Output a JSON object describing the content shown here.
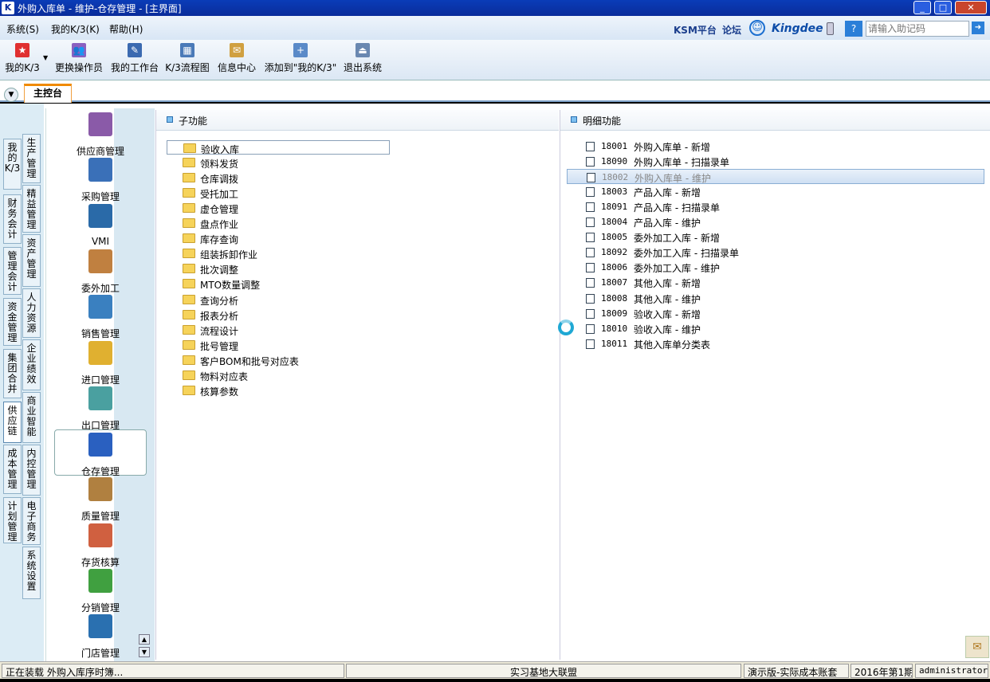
{
  "window": {
    "title": "外购入库单 - 维护-仓存管理 - [主界面]",
    "app_icon": "K",
    "min": "_",
    "max": "□",
    "close": "✕"
  },
  "menu": {
    "items": [
      "系统(S)",
      "我的K/3(K)",
      "帮助(H)"
    ],
    "ksm": "KSM平台",
    "forum": "论坛",
    "brand": "Kingdee",
    "search_placeholder": "请输入助记码"
  },
  "toolbar": {
    "items": [
      "我的K/3",
      "更换操作员",
      "我的工作台",
      "K/3流程图",
      "信息中心",
      "添加到\"我的K/3\"",
      "退出系统"
    ]
  },
  "tabs": {
    "main": "主控台"
  },
  "vtabs": {
    "col1": [
      "我的K/3",
      "财务会计",
      "管理会计",
      "资金管理",
      "集团合并",
      "供应链",
      "成本管理",
      "计划管理"
    ],
    "col2": [
      "生产管理",
      "精益管理",
      "资产管理",
      "人力资源",
      "企业绩效",
      "商业智能",
      "内控管理",
      "电子商务",
      "系统设置"
    ],
    "active": "供应链"
  },
  "modules": [
    "供应商管理",
    "采购管理",
    "VMI",
    "委外加工",
    "销售管理",
    "进口管理",
    "出口管理",
    "仓存管理",
    "质量管理",
    "存货核算",
    "分销管理",
    "门店管理"
  ],
  "active_module": "仓存管理",
  "subfunctions": {
    "title": "子功能",
    "items": [
      "验收入库",
      "领料发货",
      "仓库调拨",
      "受托加工",
      "虚仓管理",
      "盘点作业",
      "库存查询",
      "组装拆卸作业",
      "批次调整",
      "MTO数量调整",
      "查询分析",
      "报表分析",
      "流程设计",
      "批号管理",
      "客户BOM和批号对应表",
      "物料对应表",
      "核算参数"
    ],
    "selected": "验收入库"
  },
  "details": {
    "title": "明细功能",
    "items": [
      {
        "code": "18001",
        "label": "外购入库单 - 新增"
      },
      {
        "code": "18090",
        "label": "外购入库单 - 扫描录单"
      },
      {
        "code": "18002",
        "label": "外购入库单 - 维护"
      },
      {
        "code": "18003",
        "label": "产品入库 - 新增"
      },
      {
        "code": "18091",
        "label": "产品入库 - 扫描录单"
      },
      {
        "code": "18004",
        "label": "产品入库 - 维护"
      },
      {
        "code": "18005",
        "label": "委外加工入库 - 新增"
      },
      {
        "code": "18092",
        "label": "委外加工入库 - 扫描录单"
      },
      {
        "code": "18006",
        "label": "委外加工入库 - 维护"
      },
      {
        "code": "18007",
        "label": "其他入库 - 新增"
      },
      {
        "code": "18008",
        "label": "其他入库 - 维护"
      },
      {
        "code": "18009",
        "label": "验收入库 - 新增"
      },
      {
        "code": "18010",
        "label": "验收入库 - 维护"
      },
      {
        "code": "18011",
        "label": "其他入库单分类表"
      }
    ],
    "selected": "18002"
  },
  "status": {
    "loading": "正在装载 外购入库序时簿...",
    "org": "实习基地大联盟",
    "account": "演示版-实际成本账套",
    "period": "2016年第1期",
    "user": "administrator"
  },
  "colors": {
    "title_bar": "#0a2c9a",
    "accent_orange": "#f08a00",
    "selection_blue": "#cfe0f3"
  }
}
